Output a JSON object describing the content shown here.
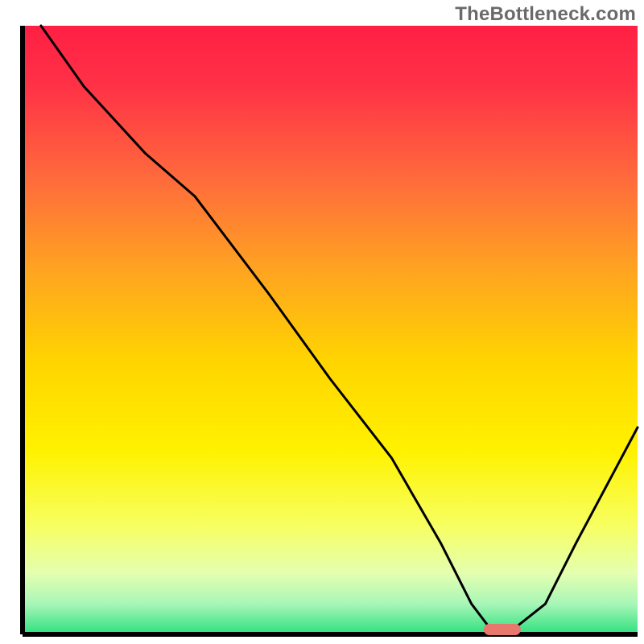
{
  "watermark": "TheBottleneck.com",
  "chart_data": {
    "type": "line",
    "title": "",
    "xlabel": "",
    "ylabel": "",
    "xlim": [
      0,
      100
    ],
    "ylim": [
      0,
      100
    ],
    "x": [
      3,
      10,
      20,
      28,
      40,
      50,
      60,
      68,
      73,
      76,
      80,
      85,
      90,
      100
    ],
    "y": [
      100,
      90,
      79,
      72,
      56,
      42,
      29,
      15,
      5,
      1,
      1,
      5,
      15,
      34
    ],
    "marker": {
      "x": 78,
      "y": 0.8,
      "color": "#e8786e"
    },
    "background_gradient": {
      "stops": [
        {
          "offset": 0.0,
          "color": "#ff1f44"
        },
        {
          "offset": 0.1,
          "color": "#ff3246"
        },
        {
          "offset": 0.25,
          "color": "#ff6a3c"
        },
        {
          "offset": 0.4,
          "color": "#ffa321"
        },
        {
          "offset": 0.55,
          "color": "#ffd400"
        },
        {
          "offset": 0.7,
          "color": "#fff200"
        },
        {
          "offset": 0.82,
          "color": "#f7ff60"
        },
        {
          "offset": 0.9,
          "color": "#e4ffb0"
        },
        {
          "offset": 0.95,
          "color": "#a8f6b8"
        },
        {
          "offset": 1.0,
          "color": "#2de07e"
        }
      ]
    }
  }
}
